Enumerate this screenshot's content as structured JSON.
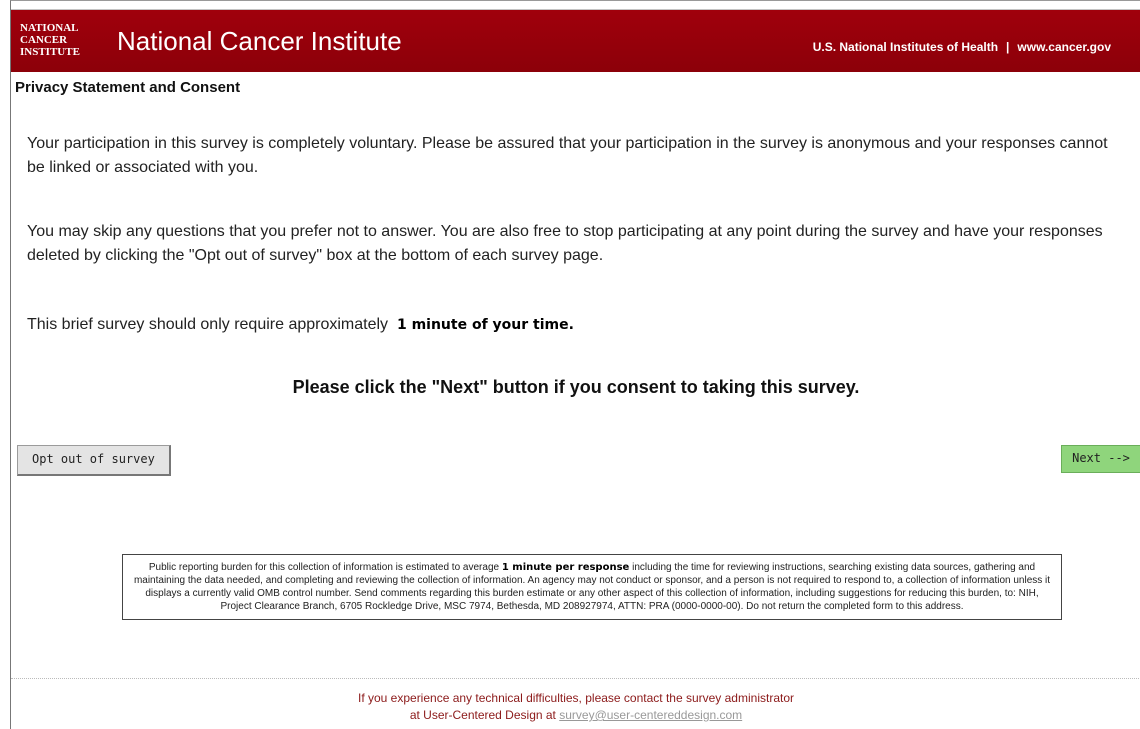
{
  "header": {
    "logo_lines": [
      "National",
      "Cancer",
      "Institute"
    ],
    "institute_name": "National Cancer Institute",
    "nih_label": "U.S. National Institutes of Health",
    "separator": "|",
    "site_link": "www.cancer.gov"
  },
  "page_title": "Privacy Statement and Consent",
  "paragraphs": {
    "p1": "Your participation in this survey is completely voluntary. Please be assured that your participation in the survey is anonymous and your responses cannot be linked or associated with you.",
    "p2": "You may skip any questions that you prefer not to answer. You are also free to stop participating at any point during the survey and have your responses deleted by clicking the \"Opt out of survey\" box at the bottom of each survey page.",
    "p3_prefix": "This brief survey should only require approximately",
    "p3_emphasis": "1 minute of your time."
  },
  "consent_text": "Please click the \"Next\" button if you consent to taking this survey.",
  "buttons": {
    "opt_out": "Opt out of survey",
    "next": "Next -->"
  },
  "burden": {
    "prefix": "Public reporting burden for this collection of information is estimated to average",
    "emphasis": "1 minute per response",
    "suffix": "including the time for reviewing instructions, searching existing data sources, gathering and maintaining the data needed, and completing and reviewing the collection of information. An agency may not conduct or sponsor, and a person is not required to respond to, a collection of information unless it displays a currently valid OMB control number. Send comments regarding this burden estimate or any other aspect of this collection of information, including suggestions for reducing this burden, to: NIH, Project Clearance Branch, 6705 Rockledge Drive, MSC 7974, Bethesda, MD 208927974, ATTN: PRA (0000-0000-00). Do not return the completed form to this address."
  },
  "footer": {
    "line1": "If you experience any technical difficulties, please contact the survey administrator",
    "line2_prefix": "at User-Centered Design at",
    "email": "survey@user-centereddesign.com"
  },
  "colors": {
    "banner": "#9a000b",
    "next_button": "#8fd57c",
    "footer_text": "#8c1a1a"
  }
}
